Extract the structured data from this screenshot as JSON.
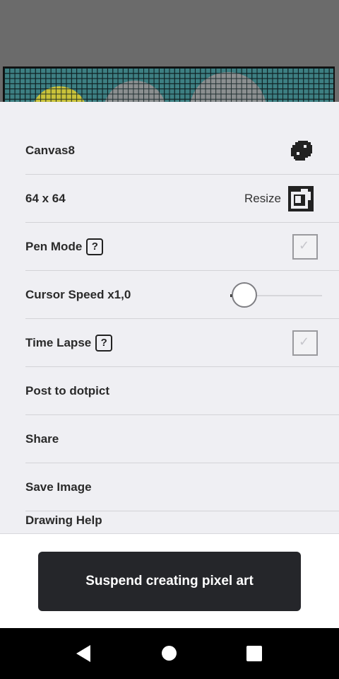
{
  "canvas": {
    "name": "Canvas8",
    "size": "64 x 64"
  },
  "settings": {
    "resize_label": "Resize",
    "pen_mode_label": "Pen Mode",
    "cursor_speed_label": "Cursor Speed x1,0",
    "cursor_speed_value": 0.0,
    "time_lapse_label": "Time Lapse",
    "help_glyph": "?",
    "pen_mode_checked": false,
    "time_lapse_checked": false
  },
  "menu": {
    "post": "Post to dotpict",
    "share": "Share",
    "save_image": "Save Image",
    "partial_next": "Drawing Help"
  },
  "actions": {
    "suspend": "Suspend creating pixel art"
  },
  "icons": {
    "canvas_settings": "palette-icon",
    "resize": "resize-icon",
    "nav_back": "back-icon",
    "nav_home": "home-icon",
    "nav_recent": "recent-apps-icon"
  },
  "colors": {
    "sheet": "#efeff3",
    "button": "#25262a",
    "canvas_teal": "#3d7f82"
  }
}
